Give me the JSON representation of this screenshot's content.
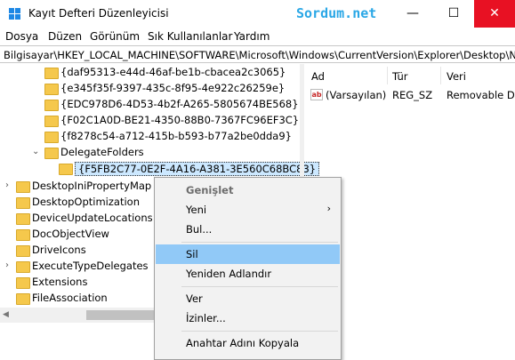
{
  "window": {
    "title": "Kayıt Defteri Düzenleyicisi",
    "watermark": "Sordum.net",
    "minimize": "—",
    "maximize": "☐",
    "close": "✕"
  },
  "menu": [
    "Dosya",
    "Düzen",
    "Görünüm",
    "Sık Kullanılanlar",
    "Yardım"
  ],
  "address": "Bilgisayar\\HKEY_LOCAL_MACHINE\\SOFTWARE\\Microsoft\\Windows\\CurrentVersion\\Explorer\\Desktop\\Nam",
  "tree": {
    "items": [
      "{daf95313-e44d-46af-be1b-cbacea2c3065}",
      "{e345f35f-9397-435c-8f95-4e922c26259e}",
      "{EDC978D6-4D53-4b2f-A265-5805674BE568}",
      "{F02C1A0D-BE21-4350-88B0-7367FC96EF3C}",
      "{f8278c54-a712-415b-b593-b77a2be0dda9}",
      "DelegateFolders",
      "{F5FB2C77-0E2F-4A16-A381-3E560C68BC83}",
      "DesktopIniPropertyMap",
      "DesktopOptimization",
      "DeviceUpdateLocations",
      "DocObjectView",
      "DriveIcons",
      "ExecuteTypeDelegates",
      "Extensions",
      "FileAssociation"
    ]
  },
  "list": {
    "headers": [
      "Ad",
      "Tür",
      "Veri"
    ],
    "rows": [
      {
        "name": "(Varsayılan)",
        "type": "REG_SZ",
        "data": "Removable Dr",
        "icon": "ab"
      }
    ]
  },
  "context_menu": {
    "items": [
      "Genişlet",
      "Yeni",
      "Bul...",
      "Sil",
      "Yeniden Adlandır",
      "Ver",
      "İzinler...",
      "Anahtar Adını Kopyala"
    ],
    "submenu_arrow": "›"
  },
  "colors": {
    "selection_highlight": "#91c9f7",
    "tree_selection": "#cce8ff",
    "close_button": "#e81123",
    "folder": "#f5c84c"
  }
}
